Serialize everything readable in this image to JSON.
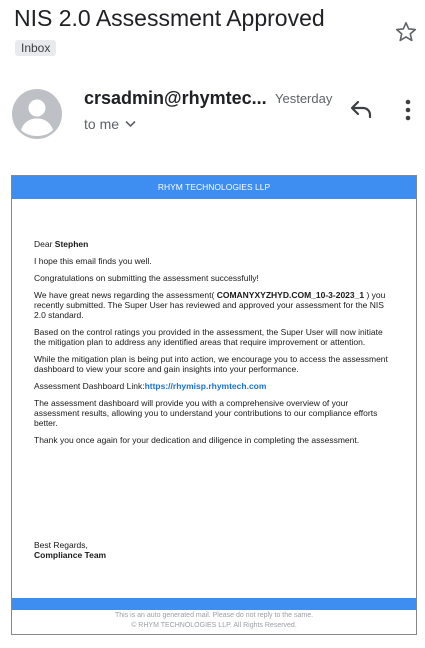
{
  "email": {
    "subject": "NIS 2.0 Assessment Approved",
    "label": "Inbox",
    "sender": "crsadmin@rhymtec...",
    "date": "Yesterday",
    "recipient": "to me",
    "icons": {
      "star": "star-outline-icon",
      "reply": "reply-icon",
      "more": "more-vert-icon",
      "expand": "chevron-down-icon",
      "avatar": "person-avatar-icon"
    }
  },
  "mail": {
    "company": "RHYM TECHNOLOGIES LLP",
    "greeting_prefix": "Dear ",
    "greeting_name": "Stephen",
    "p1": "I hope this email finds you well.",
    "p2": "Congratulations on submitting the assessment successfully!",
    "p3_a": "We have great news regarding the assessment( ",
    "p3_id": "COMANYXYZHYD.COM_10-3-2023_1",
    "p3_b": " ) you recently submitted. The Super User has reviewed and approved your assessment for the NIS 2.0 standard.",
    "p4": "Based on the control ratings you provided in the assessment, the Super User will now initiate the mitigation plan to address any identified areas that require improvement or attention.",
    "p5": "While the mitigation plan is being put into action, we encourage you to access the assessment dashboard to view your score and gain insights into your performance.",
    "p6_label": "Assessment Dashboard Link:",
    "p6_link": "https://rhymisp.rhymtech.com",
    "p7": "The assessment dashboard will provide you with a comprehensive overview of your assessment results, allowing you to understand your contributions to our compliance efforts better.",
    "p8": "Thank you once again for your dedication and diligence in completing the assessment.",
    "regards": "Best Regards,",
    "team": "Compliance Team",
    "footer_1": "This is an auto generated mail. Please do not reply to the same.",
    "footer_2": "© RHYM TECHNOLOGIES LLP. All Rights Reserved."
  },
  "colors": {
    "accent": "#3d8ef0",
    "link": "#1a73c8",
    "avatar_bg": "#bdc1c6"
  }
}
